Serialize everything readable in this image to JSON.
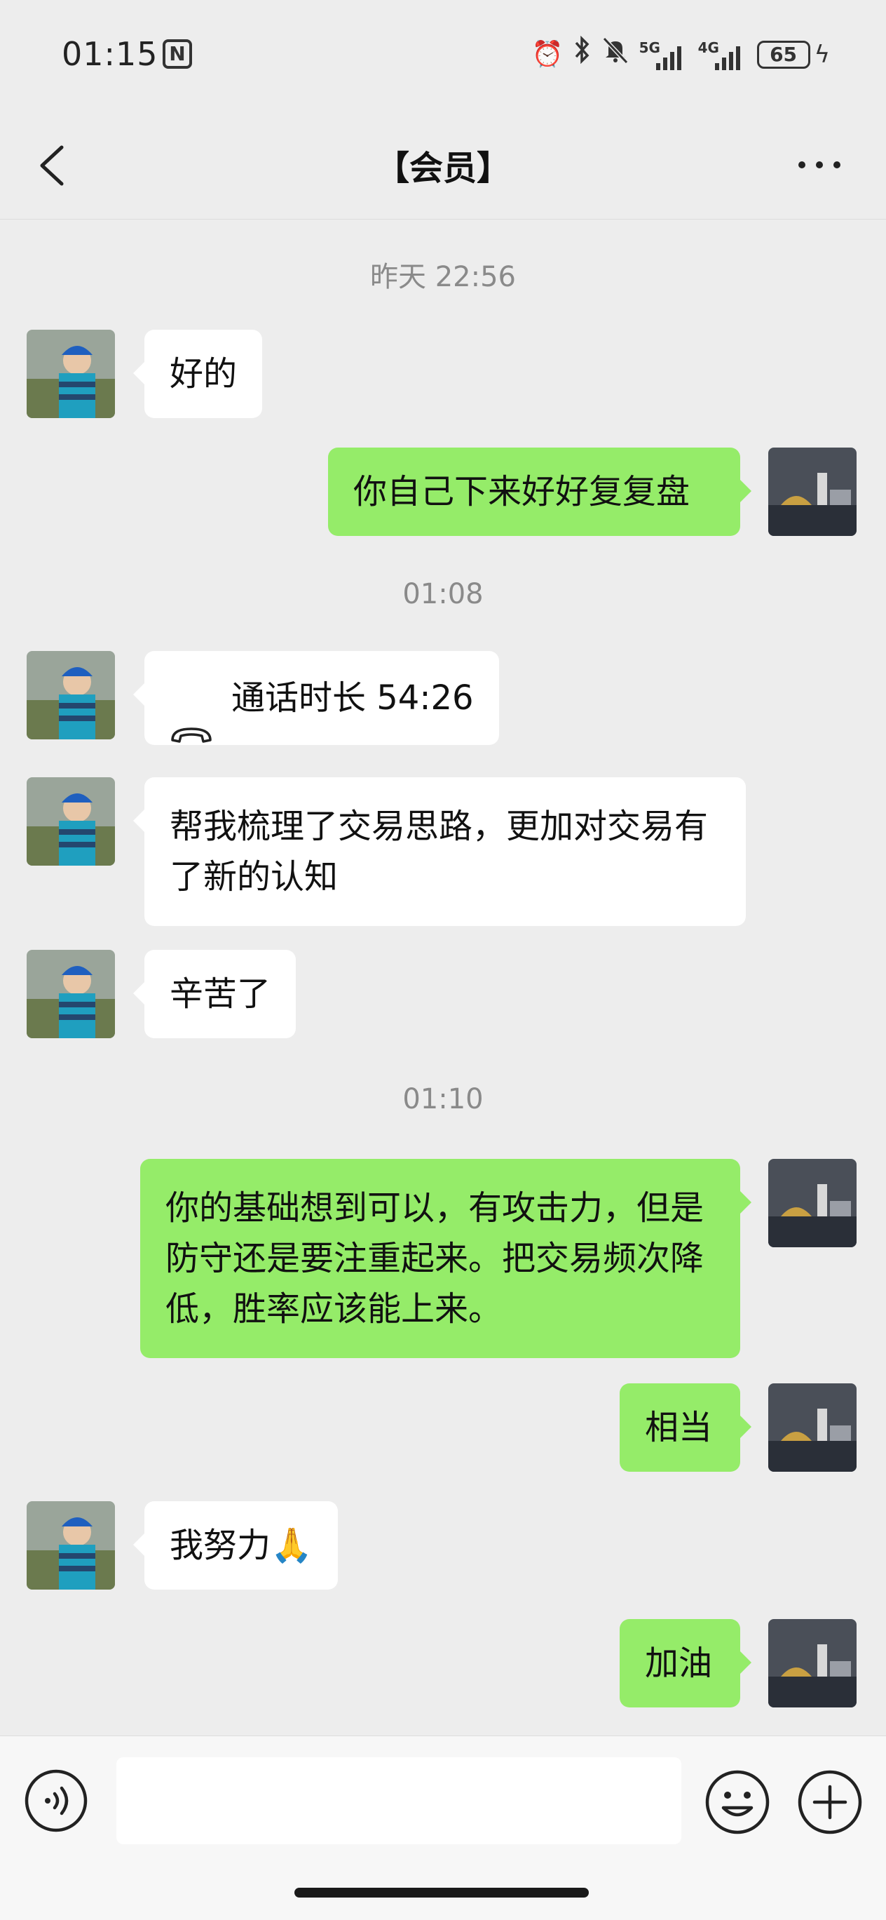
{
  "status_bar": {
    "time": "01:15",
    "nfc": "N",
    "signal1_label": "5G",
    "signal2_label": "4G",
    "battery": "65"
  },
  "nav": {
    "title": "【会员】"
  },
  "timestamps": [
    "昨天 22:56",
    "01:08",
    "01:10"
  ],
  "messages": [
    {
      "side": "in",
      "text": "好的"
    },
    {
      "side": "out",
      "text": "你自己下来好好复复盘"
    },
    {
      "side": "in",
      "type": "call",
      "text": "通话时长 54:26"
    },
    {
      "side": "in",
      "text": "帮我梳理了交易思路，更加对交易有了新的认知"
    },
    {
      "side": "in",
      "text": "辛苦了"
    },
    {
      "side": "out",
      "text": "你的基础想到可以，有攻击力，但是防守还是要注重起来。把交易频次降低，胜率应该能上来。"
    },
    {
      "side": "out",
      "text": "相当"
    },
    {
      "side": "in",
      "text": "我努力🙏"
    },
    {
      "side": "out",
      "text": "加油"
    }
  ],
  "input": {
    "placeholder": "",
    "value": ""
  },
  "colors": {
    "outgoing_bubble": "#95ec69",
    "incoming_bubble": "#ffffff",
    "background": "#ededed"
  }
}
